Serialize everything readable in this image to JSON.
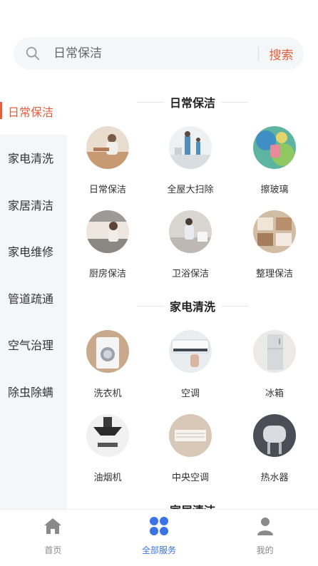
{
  "search": {
    "placeholder": "日常保洁",
    "button_label": "搜索"
  },
  "sidebar": {
    "items": [
      {
        "label": "日常保洁",
        "active": true
      },
      {
        "label": "家电清洗"
      },
      {
        "label": "家居清洁"
      },
      {
        "label": "家电维修"
      },
      {
        "label": "管道疏通"
      },
      {
        "label": "空气治理"
      },
      {
        "label": "除虫除螨"
      }
    ]
  },
  "sections": [
    {
      "title": "日常保洁",
      "items": [
        {
          "label": "日常保洁",
          "icon": "daily-cleaning-photo"
        },
        {
          "label": "全屋大扫除",
          "icon": "whole-house-cleaning-photo"
        },
        {
          "label": "擦玻璃",
          "icon": "window-cleaning-photo"
        },
        {
          "label": "厨房保洁",
          "icon": "kitchen-cleaning-photo"
        },
        {
          "label": "卫浴保洁",
          "icon": "bathroom-cleaning-photo"
        },
        {
          "label": "整理保洁",
          "icon": "organizing-photo"
        }
      ]
    },
    {
      "title": "家电清洗",
      "items": [
        {
          "label": "洗衣机",
          "icon": "washing-machine-photo"
        },
        {
          "label": "空调",
          "icon": "air-conditioner-photo"
        },
        {
          "label": "冰箱",
          "icon": "refrigerator-photo"
        },
        {
          "label": "油烟机",
          "icon": "range-hood-photo"
        },
        {
          "label": "中央空调",
          "icon": "central-ac-photo"
        },
        {
          "label": "热水器",
          "icon": "water-heater-photo"
        }
      ]
    },
    {
      "title": "家居清洁",
      "items": []
    }
  ],
  "tabbar": {
    "items": [
      {
        "label": "首页",
        "icon": "home-icon"
      },
      {
        "label": "全部服务",
        "icon": "grid-icon",
        "active": true
      },
      {
        "label": "我的",
        "icon": "user-icon"
      }
    ]
  },
  "colors": {
    "accent": "#e0603e",
    "tab_active": "#3b72e4",
    "sidebar_bg": "#f5f6f8"
  }
}
